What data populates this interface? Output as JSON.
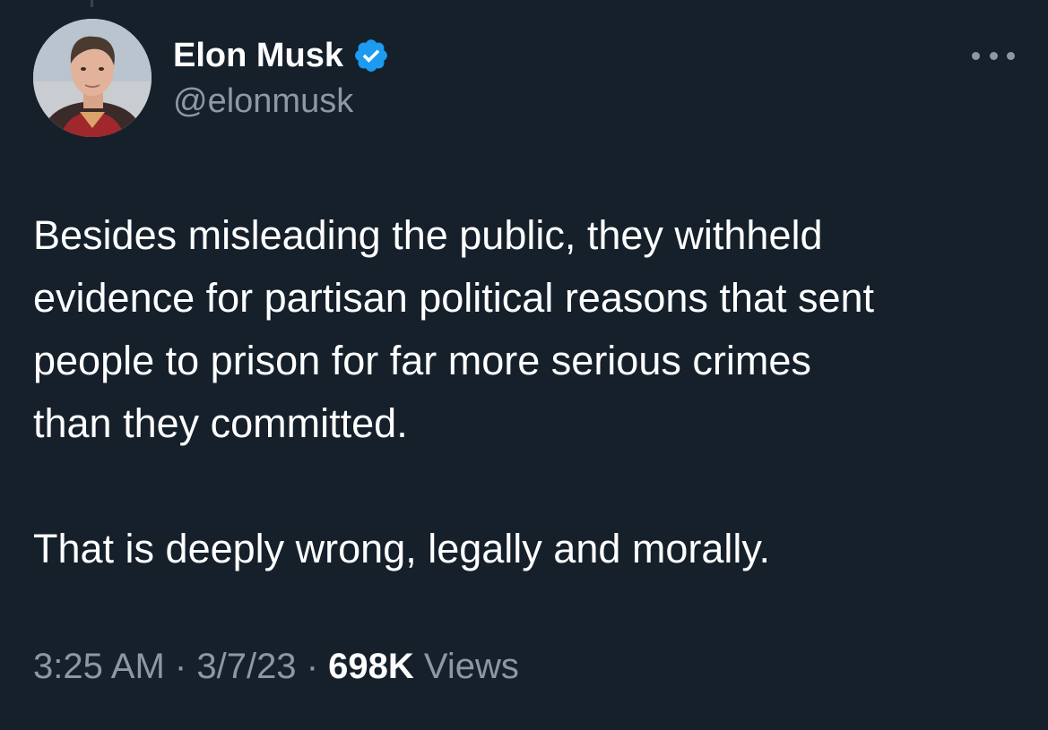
{
  "author": {
    "display_name": "Elon Musk",
    "handle": "@elonmusk",
    "verified_icon": "verified-badge-icon"
  },
  "tweet": {
    "lines": [
      "Besides misleading the public, they withheld",
      "evidence for partisan political reasons that sent",
      "people to prison for far more serious crimes",
      "than they committed."
    ],
    "closing": "That is deeply wrong, legally and morally."
  },
  "meta": {
    "time": "3:25 AM",
    "separator": "·",
    "date": "3/7/23",
    "views_count": "698K",
    "views_label": "Views"
  },
  "colors": {
    "background": "#15202b",
    "text": "#ffffff",
    "secondary": "#8b98a5",
    "verified": "#1d9bf0"
  }
}
